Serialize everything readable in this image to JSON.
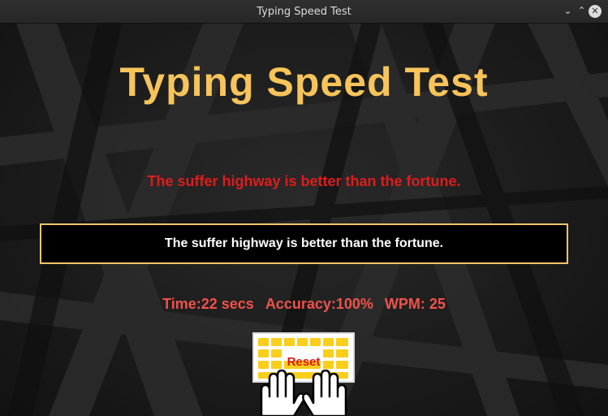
{
  "window": {
    "title": "Typing Speed Test"
  },
  "app": {
    "heading": "Typing Speed Test",
    "sentence": "The suffer highway is better than the fortune.",
    "input_value": "The suffer highway is better than the fortune.",
    "stats": {
      "time": "Time:22 secs",
      "accuracy": "Accuracy:100%",
      "wpm": "WPM: 25"
    },
    "reset_label": "Reset"
  },
  "colors": {
    "heading": "#f7c45a",
    "sentence": "#e01c1c",
    "stats": "#f0524c",
    "entry_border": "#f3c46a",
    "key_yellow": "#f9cf1c"
  },
  "icons": {
    "reset": "keyboard-hands-icon"
  }
}
